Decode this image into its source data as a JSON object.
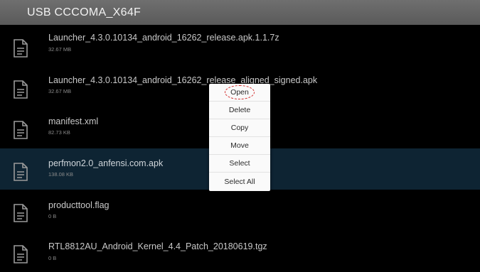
{
  "header": {
    "title": "USB CCCOMA_X64F"
  },
  "files": [
    {
      "name": "Launcher_4.3.0.10134_android_16262_release.apk.1.1.7z",
      "size": "32.67 MB",
      "selected": false
    },
    {
      "name": "Launcher_4.3.0.10134_android_16262_release_aligned_signed.apk",
      "size": "32.67 MB",
      "selected": false
    },
    {
      "name": "manifest.xml",
      "size": "82.73 KB",
      "selected": false
    },
    {
      "name": "perfmon2.0_anfensi.com.apk",
      "size": "138.08 KB",
      "selected": true
    },
    {
      "name": "producttool.flag",
      "size": "0 B",
      "selected": false
    },
    {
      "name": "RTL8812AU_Android_Kernel_4.4_Patch_20180619.tgz",
      "size": "0 B",
      "selected": false
    }
  ],
  "context_menu": {
    "items": [
      "Open",
      "Delete",
      "Copy",
      "Move",
      "Select",
      "Select All"
    ],
    "highlighted": "Open"
  },
  "colors": {
    "background": "#000000",
    "header": "#666666",
    "selected_row": "#0e2433",
    "menu_background": "#fafafa",
    "highlight_annotation": "#d12a2a"
  },
  "icons": {
    "file": "document-icon"
  }
}
